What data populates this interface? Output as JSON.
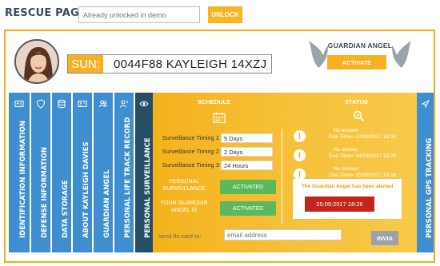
{
  "page": {
    "title": "RESCUE PAGE"
  },
  "unlock": {
    "placeholder": "Already unlocked in demo",
    "button_label": "UNLOCK"
  },
  "profile": {
    "sun_label": "SUN:",
    "sun_value": "0044F88 KAYLEIGH 14XZJ"
  },
  "guardian": {
    "title": "GUARDIAN ANGEL",
    "button_label": "ACTIVATE"
  },
  "tabs": [
    {
      "label": "IDENTIFICATION INFORMATION",
      "icon": "id-card-icon"
    },
    {
      "label": "DEFENSE INFORMATION",
      "icon": "shield-icon"
    },
    {
      "label": "DATA STORAGE",
      "icon": "database-icon"
    },
    {
      "label": "ABOUT KAYLEIGH DAVIES",
      "icon": "contact-card-icon"
    },
    {
      "label": "GUARDIAN ANGEL",
      "icon": "users-icon"
    },
    {
      "label": "PERSONAL LIFE TRACK RECORD",
      "icon": "user-record-icon"
    },
    {
      "label": "PERSONAL SURVEILLANCE",
      "icon": "eye-icon"
    },
    {
      "label": "PERSONAL GPS TRACKING",
      "icon": "gps-icon"
    }
  ],
  "schedule": {
    "heading": "SCHEDULE",
    "timings": [
      {
        "label": "Surveillance Timing 1",
        "value": "5 Days"
      },
      {
        "label": "Surveillance Timing 2",
        "value": "2 Days"
      },
      {
        "label": "Surveillance Timing 3",
        "value": "24 Hours"
      }
    ],
    "personal_surveillance_label": "PERSONAL SURVEILLANCE",
    "personal_surveillance_status": "ACTIVATED",
    "guardian_label": "YOUR GUARDIAN ANGEL IS",
    "guardian_status": "ACTIVATED"
  },
  "status": {
    "heading": "STATUS",
    "items": [
      {
        "title": "No answer",
        "date": "Due Time= 22/09/2017 18:26"
      },
      {
        "title": "No answer",
        "date": "Due Time= 24/09/2017 18:26"
      },
      {
        "title": "No answer",
        "date": "Due Time= 25/09/2017 18:26"
      }
    ],
    "alert_text": "The Guardian Angel has been alerted",
    "alert_date": "25:09:2017 18:26"
  },
  "send": {
    "label": "send thi card to:",
    "placeholder": "email address",
    "button_label": "INVIA"
  },
  "colors": {
    "accent": "#f7b01f",
    "tab_blue": "#3f8ecf",
    "tab_dark": "#264d66",
    "alert_red": "#c3241b",
    "green": "#5cb85c"
  }
}
